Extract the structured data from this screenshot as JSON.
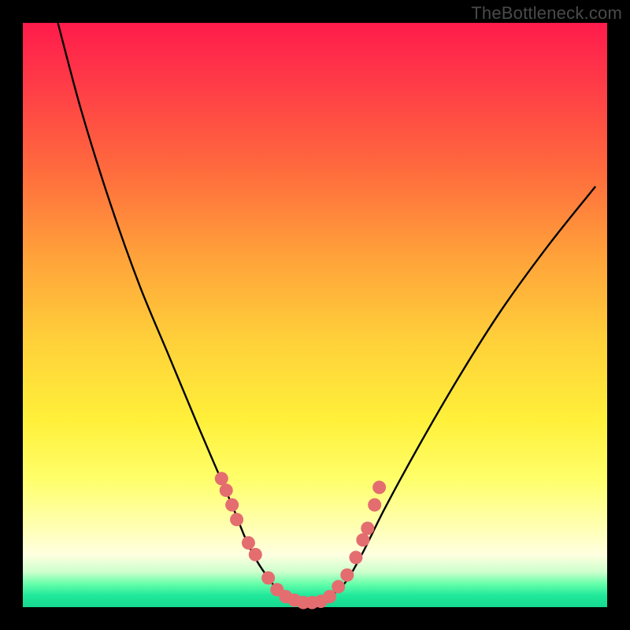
{
  "watermark": "TheBottleneck.com",
  "chart_data": {
    "type": "line",
    "title": "",
    "xlabel": "",
    "ylabel": "",
    "xlim": [
      0,
      100
    ],
    "ylim": [
      0,
      100
    ],
    "series": [
      {
        "name": "curve",
        "x": [
          6,
          10,
          15,
          20,
          25,
          30,
          33,
          36,
          38,
          40,
          42,
          44,
          46,
          48,
          50,
          52,
          55,
          58,
          62,
          68,
          75,
          82,
          90,
          98
        ],
        "y": [
          100,
          85,
          69,
          55,
          43,
          31,
          24,
          17,
          12,
          8,
          5,
          2.5,
          1.2,
          0.6,
          0.6,
          1.5,
          4,
          9,
          17,
          28,
          40,
          51,
          62,
          72
        ]
      }
    ],
    "markers": {
      "name": "dots",
      "x": [
        34.0,
        34.8,
        35.8,
        36.6,
        38.6,
        39.8,
        42.0,
        43.5,
        45.0,
        46.5,
        48.0,
        49.5,
        51.0,
        52.5,
        54.0,
        55.5,
        57.0,
        58.2,
        59.0,
        60.2,
        61.0
      ],
      "y": [
        22.0,
        20.0,
        17.5,
        15.0,
        11.0,
        9.0,
        5.0,
        3.0,
        1.8,
        1.2,
        0.8,
        0.8,
        1.0,
        1.8,
        3.5,
        5.5,
        8.5,
        11.5,
        13.5,
        17.5,
        20.5
      ]
    },
    "colors": {
      "curve": "#000000",
      "markers": "#e46d6f",
      "gradient_top": "#ff1b4b",
      "gradient_mid": "#ffe03a",
      "gradient_bottom": "#15d88f"
    }
  }
}
